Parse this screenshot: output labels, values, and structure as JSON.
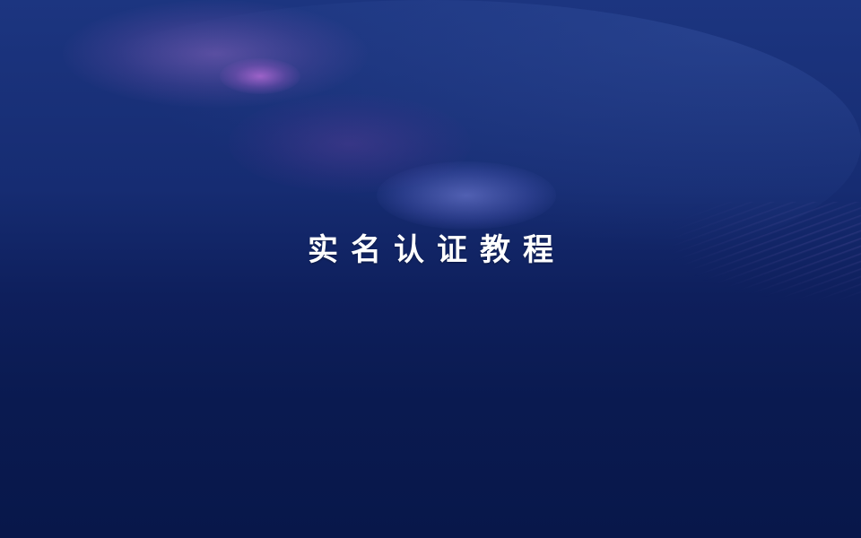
{
  "slide": {
    "title": "实名认证教程"
  },
  "colors": {
    "background_top": "#1c3580",
    "background_bottom": "#08174a",
    "title_text": "#ffffff",
    "glow_purple": "#b46edc",
    "glow_blue": "#7882dc"
  }
}
